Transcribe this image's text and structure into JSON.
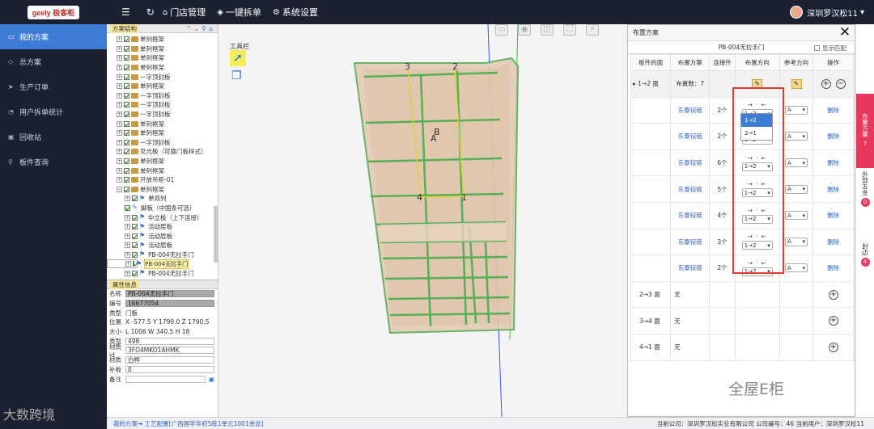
{
  "app": {
    "logo_text": "geely 极客柜",
    "brand_color": "#1b2130",
    "accent": "#3d7dd6"
  },
  "topnav": {
    "items": [
      {
        "icon": "home-icon",
        "label": "门店管理"
      },
      {
        "icon": "shield-icon",
        "label": "一键拆单"
      },
      {
        "icon": "gear-icon",
        "label": "系统设置"
      }
    ],
    "user": "深圳罗汉松11"
  },
  "sidebar": {
    "items": [
      {
        "icon": "monitor-icon",
        "label": "我的方案",
        "active": true
      },
      {
        "icon": "diamond-icon",
        "label": "总方案"
      },
      {
        "icon": "send-icon",
        "label": "生产订单"
      },
      {
        "icon": "chart-icon",
        "label": "用户拆单统计"
      },
      {
        "icon": "trash-icon",
        "label": "回收站"
      },
      {
        "icon": "search-icon",
        "label": "板件查询"
      }
    ]
  },
  "tree": {
    "title": "方案结构",
    "nodes": [
      {
        "label": "单列框架",
        "type": "frame"
      },
      {
        "label": "单列框架",
        "type": "frame"
      },
      {
        "label": "单列框架",
        "type": "frame"
      },
      {
        "label": "单列框架",
        "type": "frame"
      },
      {
        "label": "一字顶封板",
        "type": "frame"
      },
      {
        "label": "单列框架",
        "type": "frame"
      },
      {
        "label": "一字顶封板",
        "type": "frame"
      },
      {
        "label": "一字顶封板",
        "type": "frame"
      },
      {
        "label": "一字顶封板",
        "type": "frame"
      },
      {
        "label": "单列框架",
        "type": "frame"
      },
      {
        "label": "单列框架",
        "type": "frame"
      },
      {
        "label": "一字顶封板",
        "type": "frame"
      },
      {
        "label": "见光板（可换门板样式）",
        "type": "frame"
      },
      {
        "label": "单列框架",
        "type": "frame"
      },
      {
        "label": "单列框架",
        "type": "frame"
      },
      {
        "label": "开放吊柜-01",
        "type": "frame"
      },
      {
        "label": "单列框架",
        "type": "frame",
        "expanded": true
      },
      {
        "label": "单双列",
        "type": "flag",
        "level": 2
      },
      {
        "label": "脚板（中国条可选）",
        "type": "pencil",
        "level": 2
      },
      {
        "label": "中立板（上下连接）",
        "type": "flag",
        "level": 2
      },
      {
        "label": "活动层板",
        "type": "flag",
        "level": 2
      },
      {
        "label": "活动层板",
        "type": "flag",
        "level": 2
      },
      {
        "label": "活动层板",
        "type": "flag",
        "level": 2
      },
      {
        "label": "PB-004无拉手门",
        "type": "flag",
        "level": 2
      },
      {
        "label": "PB-004无拉手门",
        "type": "flag",
        "level": 2,
        "selected": true
      },
      {
        "label": "PB-004无拉手门",
        "type": "flag",
        "level": 2
      }
    ]
  },
  "props": {
    "title": "属性信息",
    "rows": [
      {
        "k": "名称",
        "v": "PB-004无拉手门",
        "style": "dark"
      },
      {
        "k": "编号",
        "v": "16677054",
        "style": "dark"
      },
      {
        "k": "类型",
        "v": "门板",
        "style": "plain"
      },
      {
        "k": "位置",
        "v": "X -577.5  Y 1799.0  Z 1790.5",
        "style": "plain"
      },
      {
        "k": "大小",
        "v": "L 1006    W 340.5    H 18",
        "style": "plain"
      },
      {
        "k": "类型",
        "v": "498",
        "style": "input"
      },
      {
        "k": "材质id",
        "v": "3FO4MKO1AHMK",
        "style": "input"
      },
      {
        "k": "材质",
        "v": "白桦",
        "style": "input"
      },
      {
        "k": "补板",
        "v": "0",
        "style": "input"
      },
      {
        "k": "备注",
        "v": "",
        "style": "input"
      }
    ]
  },
  "canvas": {
    "toolbar_label": "工具栏",
    "labels": [
      "3",
      "2",
      "B",
      "A",
      "4",
      "1"
    ]
  },
  "dialog": {
    "title": "布置方案",
    "subtitle": "PB-004无拉手门",
    "match_label": "显示匹配",
    "headers": [
      "板件的面",
      "布置方案",
      "连接件",
      "布置方向",
      "参考方向",
      "操作"
    ],
    "main_row": {
      "face": "1→2 面",
      "count": "布置数：7"
    },
    "rows": [
      {
        "scheme": "东泰铰链",
        "qty": "2个",
        "dir": "1→2",
        "ref": "A",
        "op": "删除"
      },
      {
        "scheme": "东泰铰链",
        "qty": "2个",
        "dir": "1→2",
        "ref": "A",
        "op": "删除"
      },
      {
        "scheme": "东泰铰链",
        "qty": "6个",
        "dir": "1→2",
        "ref": "A",
        "op": "删除"
      },
      {
        "scheme": "东泰铰链",
        "qty": "5个",
        "dir": "1→2",
        "ref": "A",
        "op": "删除"
      },
      {
        "scheme": "东泰铰链",
        "qty": "4个",
        "dir": "1→2",
        "ref": "A",
        "op": "删除"
      },
      {
        "scheme": "东泰铰链",
        "qty": "3个",
        "dir": "1→2",
        "ref": "A",
        "op": "删除"
      },
      {
        "scheme": "东泰铰链",
        "qty": "2个",
        "dir": "1→2",
        "ref": "A",
        "op": "删除"
      }
    ],
    "faces": [
      {
        "face": "2→3 面",
        "scheme": "无"
      },
      {
        "face": "3→4 面",
        "scheme": "无"
      },
      {
        "face": "4→1 面",
        "scheme": "无"
      }
    ],
    "dropdown_options": [
      "1→2",
      "2→1"
    ]
  },
  "rightbar": [
    {
      "label": "布置方案",
      "count": "7",
      "active": true
    },
    {
      "label": "外部五金",
      "count": "0"
    },
    {
      "label": "封边",
      "count": "4"
    }
  ],
  "footer": {
    "breadcrumb": "我的方案➜ 工艺配置[广西国学华府5栋1单元1001余总]",
    "right": "当前公司：深圳罗汉松实业有限公司  公司编号：46  当前用户：深圳罗汉松11"
  },
  "watermarks": {
    "left": "大数跨境",
    "right": "全屋E柜"
  }
}
